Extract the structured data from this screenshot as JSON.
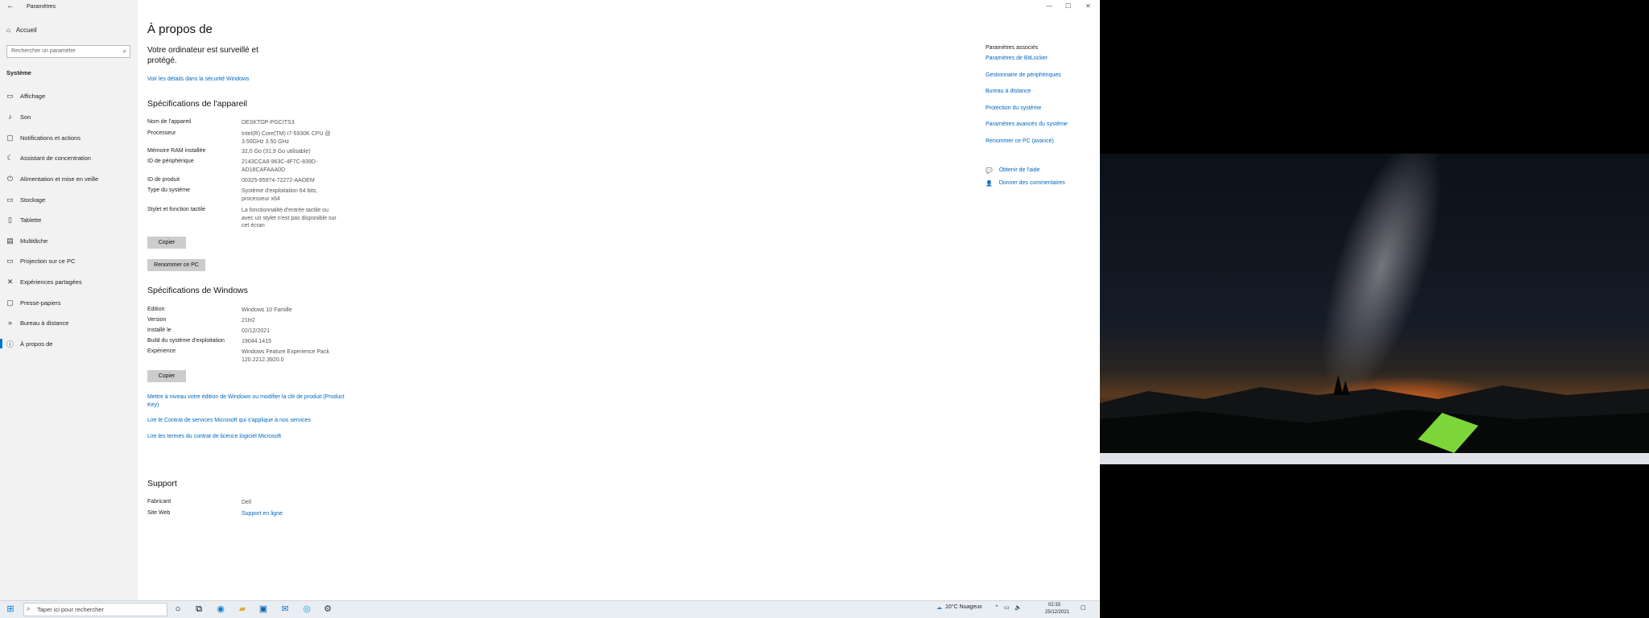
{
  "window": {
    "title": "Paramètres",
    "controls": {
      "minimize": "—",
      "maximize": "☐",
      "close": "✕"
    }
  },
  "sidebar": {
    "home": "Accueil",
    "search_placeholder": "Rechercher un paramètre",
    "group": "Système",
    "items": [
      {
        "label": "Affichage",
        "icon": "display-icon"
      },
      {
        "label": "Son",
        "icon": "speaker-icon"
      },
      {
        "label": "Notifications et actions",
        "icon": "notification-icon"
      },
      {
        "label": "Assistant de concentration",
        "icon": "moon-icon"
      },
      {
        "label": "Alimentation et mise en veille",
        "icon": "power-icon"
      },
      {
        "label": "Stockage",
        "icon": "storage-icon"
      },
      {
        "label": "Tablette",
        "icon": "tablet-icon"
      },
      {
        "label": "Multitâche",
        "icon": "multitask-icon"
      },
      {
        "label": "Projection sur ce PC",
        "icon": "projection-icon"
      },
      {
        "label": "Expériences partagées",
        "icon": "shared-icon"
      },
      {
        "label": "Presse-papiers",
        "icon": "clipboard-icon"
      },
      {
        "label": "Bureau à distance",
        "icon": "remote-icon"
      },
      {
        "label": "À propos de",
        "icon": "info-icon"
      }
    ]
  },
  "main": {
    "title": "À propos de",
    "security": {
      "headline": "Votre ordinateur est surveillé et protégé.",
      "link": "Voir les détails dans la sécurité Windows"
    },
    "device_specs": {
      "title": "Spécifications de l'appareil",
      "rows": [
        {
          "key": "Nom de l'appareil",
          "value": "DESKTOP-PGCITS3"
        },
        {
          "key": "Processeur",
          "value": "Intel(R) Core(TM) i7-5930K CPU @ 3.50GHz   3.50 GHz"
        },
        {
          "key": "Mémoire RAM installée",
          "value": "32,0 Go (31,9 Go utilisable)"
        },
        {
          "key": "ID de périphérique",
          "value": "2143CCA8-963C-4F7C-839D-AD18CAFAAA0D"
        },
        {
          "key": "ID de produit",
          "value": "00325-95974-72272-AAOEM"
        },
        {
          "key": "Type du système",
          "value": "Système d'exploitation 64 bits, processeur x64"
        },
        {
          "key": "Stylet et fonction tactile",
          "value": "La fonctionnalité d'entrée tactile ou avec un stylet n'est pas disponible sur cet écran"
        }
      ],
      "copy_button": "Copier",
      "rename_button": "Renommer ce PC"
    },
    "windows_specs": {
      "title": "Spécifications de Windows",
      "rows": [
        {
          "key": "Edition",
          "value": "Windows 10 Famille"
        },
        {
          "key": "Version",
          "value": "21H2"
        },
        {
          "key": "Installé le",
          "value": "02/12/2021"
        },
        {
          "key": "Build du système d'exploitation",
          "value": "19044.1415"
        },
        {
          "key": "Expérience",
          "value": "Windows Feature Experience Pack 120.2212.3920.0"
        }
      ],
      "copy_button": "Copier"
    },
    "links": [
      "Mettre à niveau votre édition de Windows ou modifier la clé de produit (Product Key)",
      "Lire le Contrat de services Microsoft qui s'applique à nos services",
      "Lire les termes du contrat de licence logiciel Microsoft"
    ],
    "support": {
      "title": "Support",
      "rows": [
        {
          "key": "Fabricant",
          "value": "Dell"
        },
        {
          "key": "Site Web",
          "value": "Support en ligne"
        }
      ]
    }
  },
  "related": {
    "title": "Paramètres associés",
    "links": [
      "Paramètres de BitLocker",
      "Gestionnaire de périphériques",
      "Bureau à distance",
      "Protection du système",
      "Paramètres avancés du système",
      "Renommer ce PC (avancé)"
    ],
    "help": "Obtenir de l'aide",
    "feedback": "Donner des commentaires"
  },
  "taskbar": {
    "search_placeholder": "Taper ici pour rechercher",
    "weather": "10°C  Nuageux",
    "time": "02:33",
    "date": "25/12/2021"
  }
}
